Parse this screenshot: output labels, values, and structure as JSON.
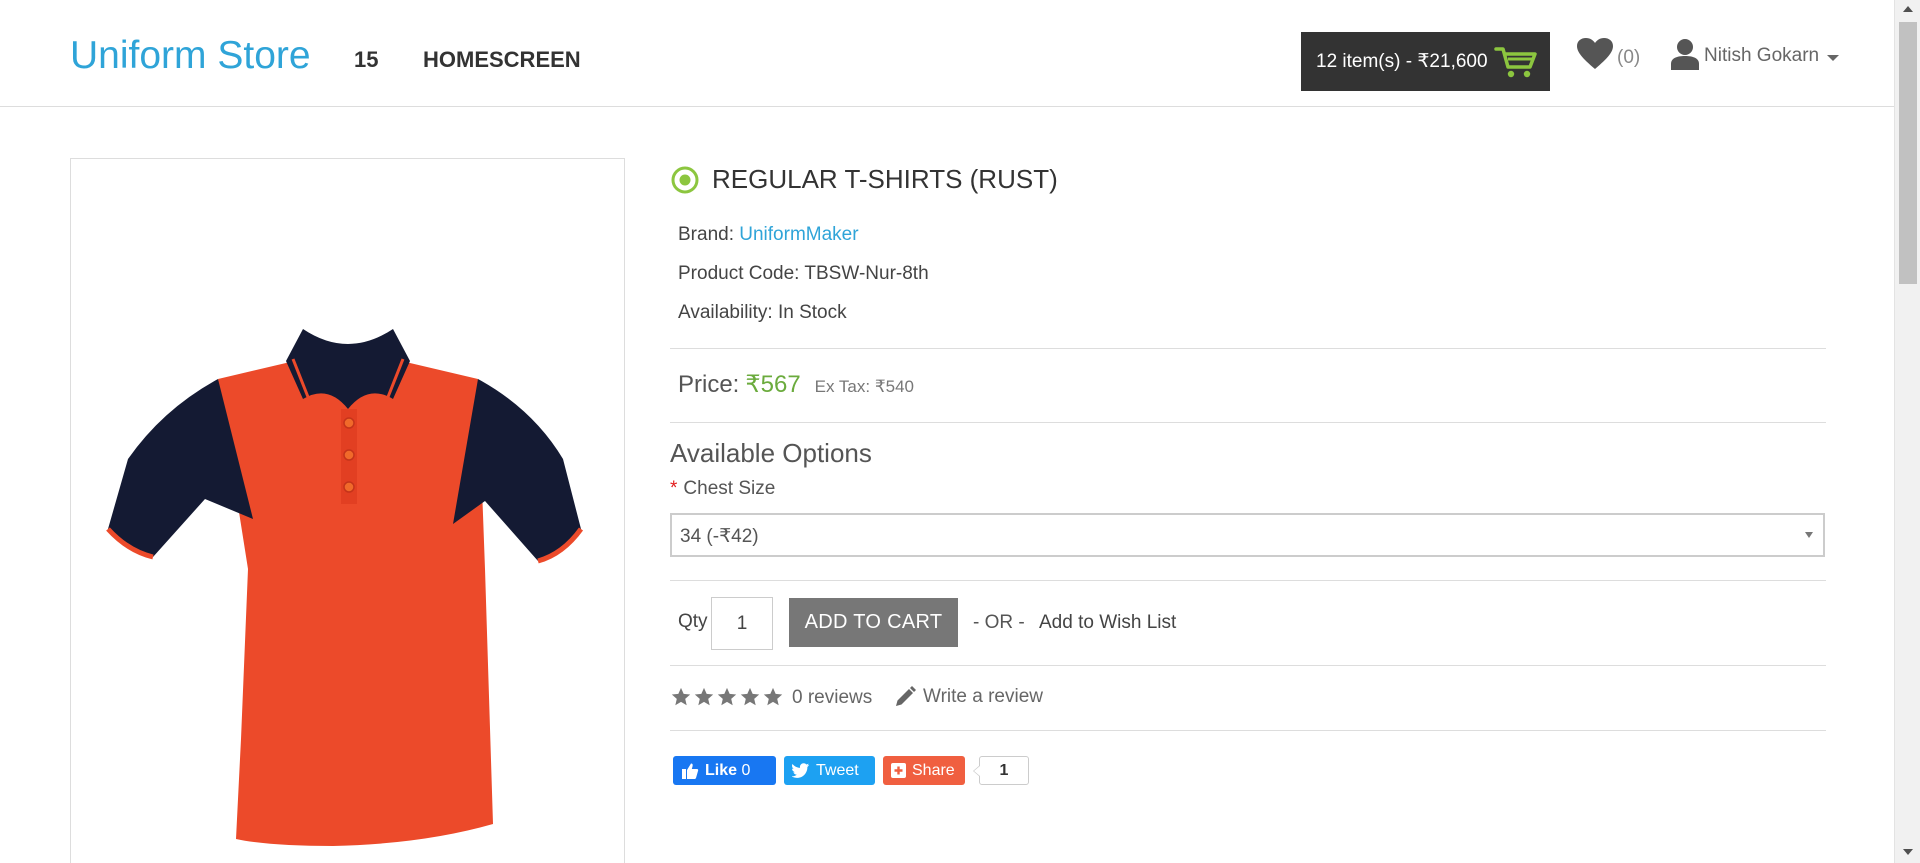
{
  "header": {
    "logo": "Uniform Store",
    "nav": [
      "15",
      "HOMESCREEN"
    ],
    "cart_label": "12 item(s) - ₹21,600",
    "wishlist_count": "(0)",
    "user_name": "Nitish Gokarn"
  },
  "product": {
    "title": "REGULAR T-SHIRTS (RUST)",
    "brand_label": "Brand:",
    "brand_value": "UniformMaker",
    "code_label": "Product Code:",
    "code_value": "TBSW-Nur-8th",
    "availability_label": "Availability:",
    "availability_value": "In Stock",
    "price_label": "Price:",
    "price_value": "₹567",
    "ex_tax": "Ex Tax: ₹540"
  },
  "options": {
    "heading": "Available Options",
    "required_mark": "*",
    "chest_label": "Chest Size",
    "chest_selected": "34 (-₹42)"
  },
  "purchase": {
    "qty_label": "Qty",
    "qty_value": "1",
    "add_to_cart": "ADD TO CART",
    "or_text": "- OR -",
    "add_wishlist": "Add to Wish List"
  },
  "reviews": {
    "rating": 0,
    "max_rating": 5,
    "reviews_text": "0 reviews",
    "write_text": "Write a review"
  },
  "social": {
    "like": "Like",
    "like_count": "0",
    "tweet": "Tweet",
    "share": "Share",
    "share_count": "1"
  },
  "colors": {
    "brand_blue": "#2fa4d8",
    "price_green": "#6bab3d",
    "cart_bg": "#333333",
    "shirt_body": "#ec4a2a",
    "shirt_sleeves": "#141a33"
  }
}
